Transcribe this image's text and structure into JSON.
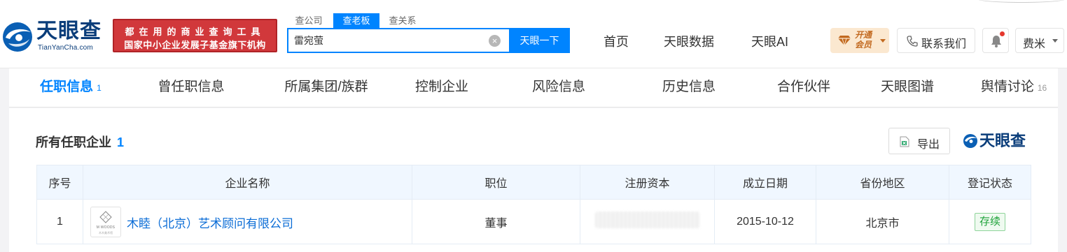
{
  "header": {
    "logo": {
      "cn": "天眼查",
      "en": "TianYanCha.com"
    },
    "promo": {
      "line1": "都在用的商业查询工具",
      "line2": "国家中小企业发展子基金旗下机构"
    },
    "search_tabs": [
      "查公司",
      "查老板",
      "查关系"
    ],
    "search_active_tab": "查老板",
    "search": {
      "value": "雷宛萤",
      "button": "天眼一下"
    },
    "nav": [
      "首页",
      "天眼数据",
      "天眼AI"
    ],
    "vip": {
      "label": "开通会员"
    },
    "contact": {
      "label": "联系我们"
    },
    "user": {
      "name": "费米"
    }
  },
  "tabs": [
    {
      "label": "任职信息",
      "count": "1",
      "active": true
    },
    {
      "label": "曾任职信息",
      "count": ""
    },
    {
      "label": "所属集团/族群",
      "count": ""
    },
    {
      "label": "控制企业",
      "count": ""
    },
    {
      "label": "风险信息",
      "count": ""
    },
    {
      "label": "历史信息",
      "count": ""
    },
    {
      "label": "合作伙伴",
      "count": ""
    },
    {
      "label": "天眼图谱",
      "count": ""
    },
    {
      "label": "舆情讨论",
      "count": "16"
    }
  ],
  "section": {
    "title": "所有任职企业",
    "count": "1",
    "export_label": "导出",
    "watermark": "天眼查"
  },
  "table": {
    "headers": [
      "序号",
      "企业名称",
      "职位",
      "注册资本",
      "成立日期",
      "省份地区",
      "登记状态"
    ],
    "rows": [
      {
        "index": "1",
        "company": "木睦（北京）艺术顾问有限公司",
        "logo_text": "M WOODS",
        "logo_sub": "木木美术馆",
        "position": "董事",
        "capital": "",
        "founded": "2015-10-12",
        "region": "北京市",
        "status": "存续"
      }
    ]
  },
  "colors": {
    "brand_blue": "#0084ff",
    "logo_navy": "#0a3d7a",
    "promo_red": "#d1383b",
    "status_green": "#1fa33a",
    "link_blue": "#0a6cd6"
  }
}
